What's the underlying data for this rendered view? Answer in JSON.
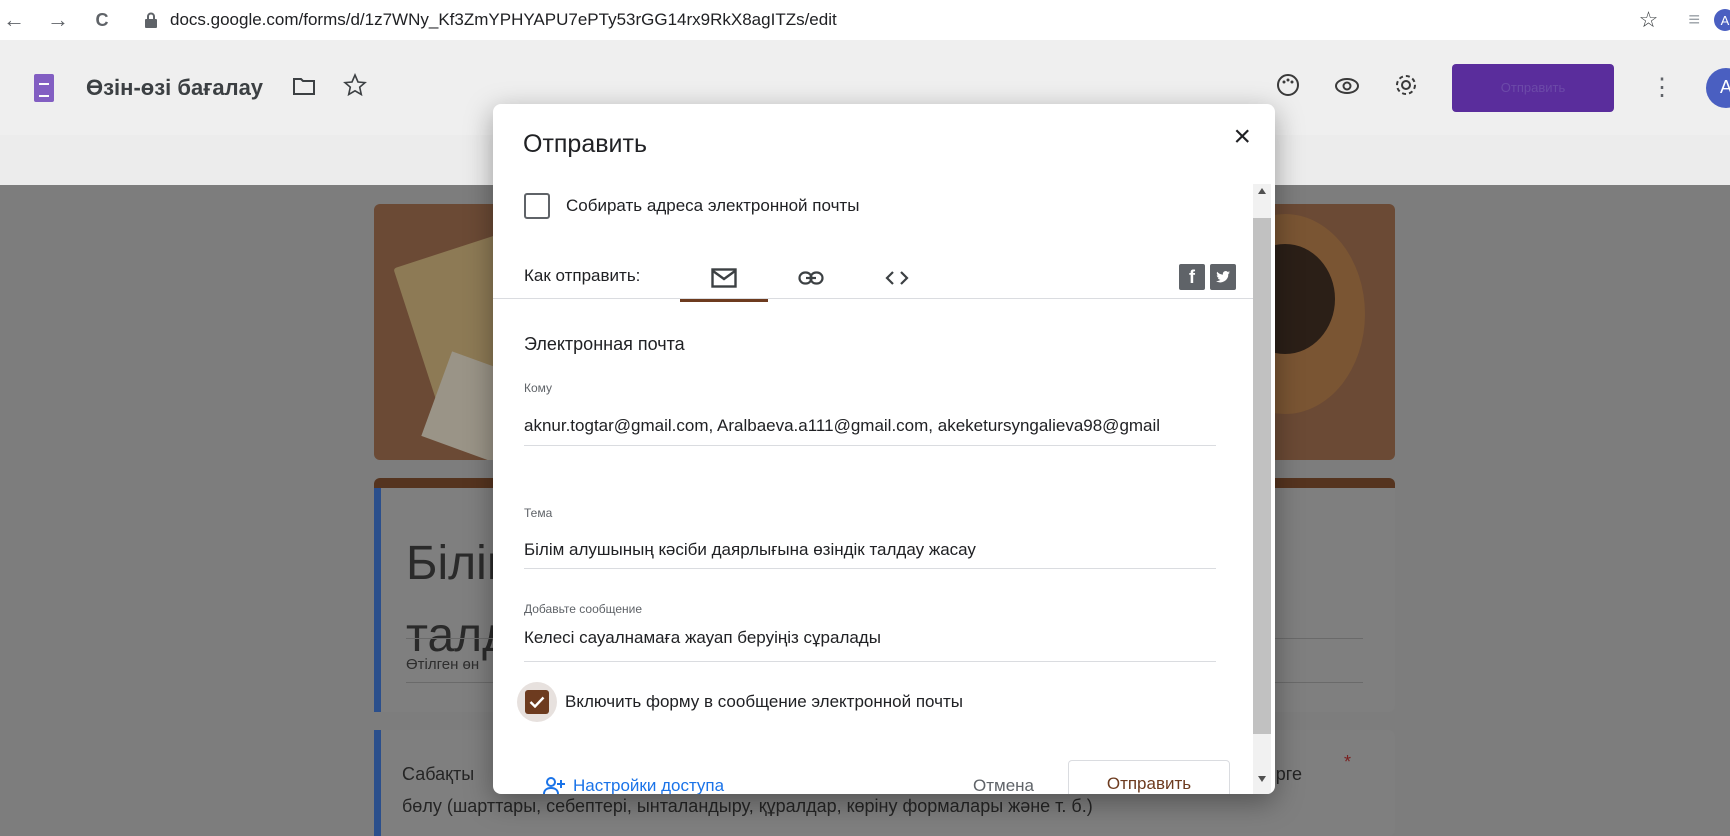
{
  "browser": {
    "back_icon": "←",
    "forward_icon": "→",
    "reload_icon": "C",
    "url": "docs.google.com/forms/d/1z7WNy_Kf3ZmYPHYAPU7ePTy53rGG14rx9RkX8agITZs/edit",
    "star_icon": "☆",
    "menu_icon": "≡",
    "profile_initial": "A"
  },
  "app": {
    "title": "Өзін-өзі бағалау",
    "send_button": "Отправить",
    "avatar_initial": "A",
    "accent_color": "#673ab7"
  },
  "form": {
    "title_lines": [
      "Білім",
      "талд"
    ],
    "title_sub": "Өтілген өн",
    "question_text": "Сабақты... ...рге бөлу (шарттары, себептері, ынталандыру, құралдар, көріну формалары және т. б.)",
    "question_line1_start": "Сабақты",
    "question_line1_end": "рге",
    "question_line2": "бөлу (шарттары, себептері, ынталандыру, құралдар, көріну формалары және т. б.)",
    "required_mark": "*"
  },
  "modal": {
    "title": "Отправить",
    "close_icon": "×",
    "collect_emails_label": "Собирать адреса электронной почты",
    "collect_emails_checked": false,
    "how_to_send_label": "Как отправить:",
    "active_tab": "email",
    "section_title": "Электронная почта",
    "to_label": "Кому",
    "to_value": "aknur.togtar@gmail.com, Aralbaeva.a111@gmail.com, akeketursyngalieva98@gmail",
    "subject_label": "Тема",
    "subject_value": "Білім алушының кәсіби даярлығына өзіндік талдау жасау",
    "message_label": "Добавьте сообщение",
    "message_value": "Келесі сауалнамаға жауап беруіңіз сұралады",
    "include_form_label": "Включить форму в сообщение электронной почты",
    "include_form_checked": true,
    "access_settings_label": "Настройки доступа",
    "cancel_label": "Отмена",
    "send_label": "Отправить",
    "accent_color": "#6d3b1f"
  }
}
